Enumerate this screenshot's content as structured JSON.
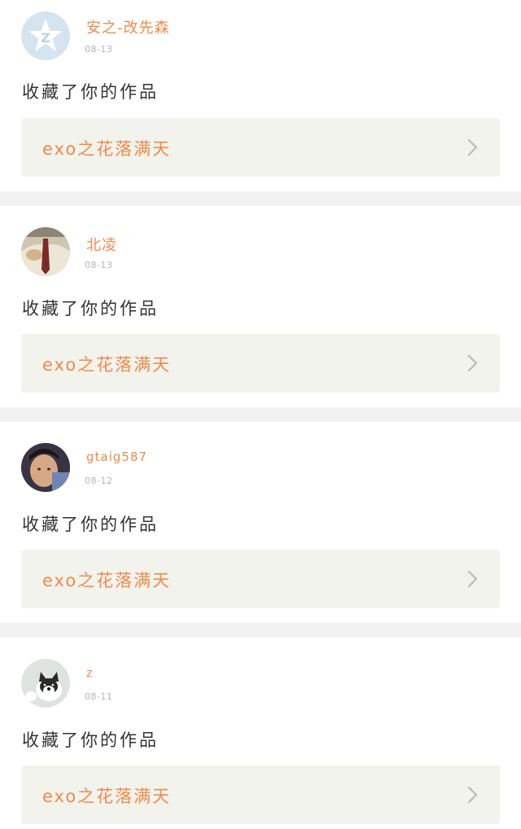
{
  "notifications": [
    {
      "username": "安之-改先森",
      "date": "08-13",
      "action": "收藏了你的作品",
      "work_title": "exo之花落满天",
      "avatar_icon": "qq-default-avatar"
    },
    {
      "username": "北凌",
      "date": "08-13",
      "action": "收藏了你的作品",
      "work_title": "exo之花落满天",
      "avatar_icon": "person-tie-avatar"
    },
    {
      "username": "gtaig587",
      "date": "08-12",
      "action": "收藏了你的作品",
      "work_title": "exo之花落满天",
      "avatar_icon": "person-face-avatar"
    },
    {
      "username": "z",
      "date": "08-11",
      "action": "收藏了你的作品",
      "work_title": "exo之花落满天",
      "avatar_icon": "husky-dog-avatar"
    }
  ],
  "colors": {
    "accent": "#f08a4b",
    "date_gray": "#b5b5b5",
    "text_dark": "#333333",
    "box_bg": "#f3f3ee",
    "separator": "#f2f2f2"
  }
}
